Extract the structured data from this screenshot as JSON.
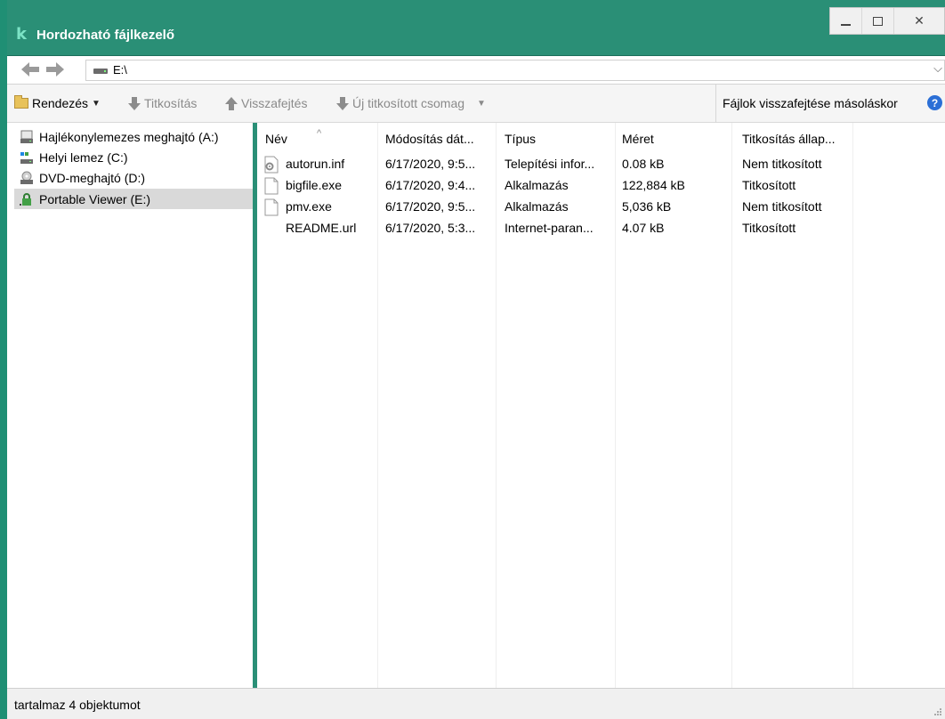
{
  "window": {
    "title": "Hordozható fájlkezelő",
    "logo": "k",
    "controls": [
      "minimize",
      "maximize",
      "close"
    ],
    "close_glyph": "✕"
  },
  "address": {
    "path": "E:\\",
    "dropdown_glyph": "⌵"
  },
  "toolbar": {
    "organize": "Rendezés",
    "encrypt": "Titkosítás",
    "decrypt": "Visszafejtés",
    "new_package": "Új titkosított csomag",
    "decrypt_on_copy": "Fájlok visszafejtése másoláskor",
    "help": "?"
  },
  "tree": {
    "items": [
      {
        "label": "Hajlékonylemezes meghajtó (A:)",
        "icon": "floppy-drive-icon",
        "selected": false
      },
      {
        "label": "Helyi lemez (C:)",
        "icon": "local-disk-icon",
        "selected": false
      },
      {
        "label": "DVD-meghajtó (D:)",
        "icon": "dvd-drive-icon",
        "selected": false
      },
      {
        "label": "Portable Viewer (E:)",
        "icon": "encrypted-drive-icon",
        "selected": true
      }
    ]
  },
  "list": {
    "columns": [
      "Név",
      "Módosítás dát...",
      "Típus",
      "Méret",
      "Titkosítás állap..."
    ],
    "sort_glyph": "^",
    "rows": [
      {
        "name": "autorun.inf",
        "icon": "settings-file-icon",
        "modified": "6/17/2020, 9:5...",
        "type": "Telepítési infor...",
        "size": "0.08 kB",
        "status": "Nem titkosított"
      },
      {
        "name": "bigfile.exe",
        "icon": "file-icon",
        "modified": "6/17/2020, 9:4...",
        "type": "Alkalmazás",
        "size": "122,884 kB",
        "status": "Titkosított"
      },
      {
        "name": "pmv.exe",
        "icon": "file-icon",
        "modified": "6/17/2020, 9:5...",
        "type": "Alkalmazás",
        "size": "5,036 kB",
        "status": "Nem titkosított"
      },
      {
        "name": "README.url",
        "icon": "none",
        "modified": "6/17/2020, 5:3...",
        "type": "Internet-paran...",
        "size": "4.07 kB",
        "status": "Titkosított"
      }
    ]
  },
  "status": {
    "text": "tartalmaz 4 objektumot"
  },
  "colors": {
    "title_bar": "#2a8f76",
    "selection": "#d9d9d9",
    "help_icon": "#2b6fd6"
  }
}
